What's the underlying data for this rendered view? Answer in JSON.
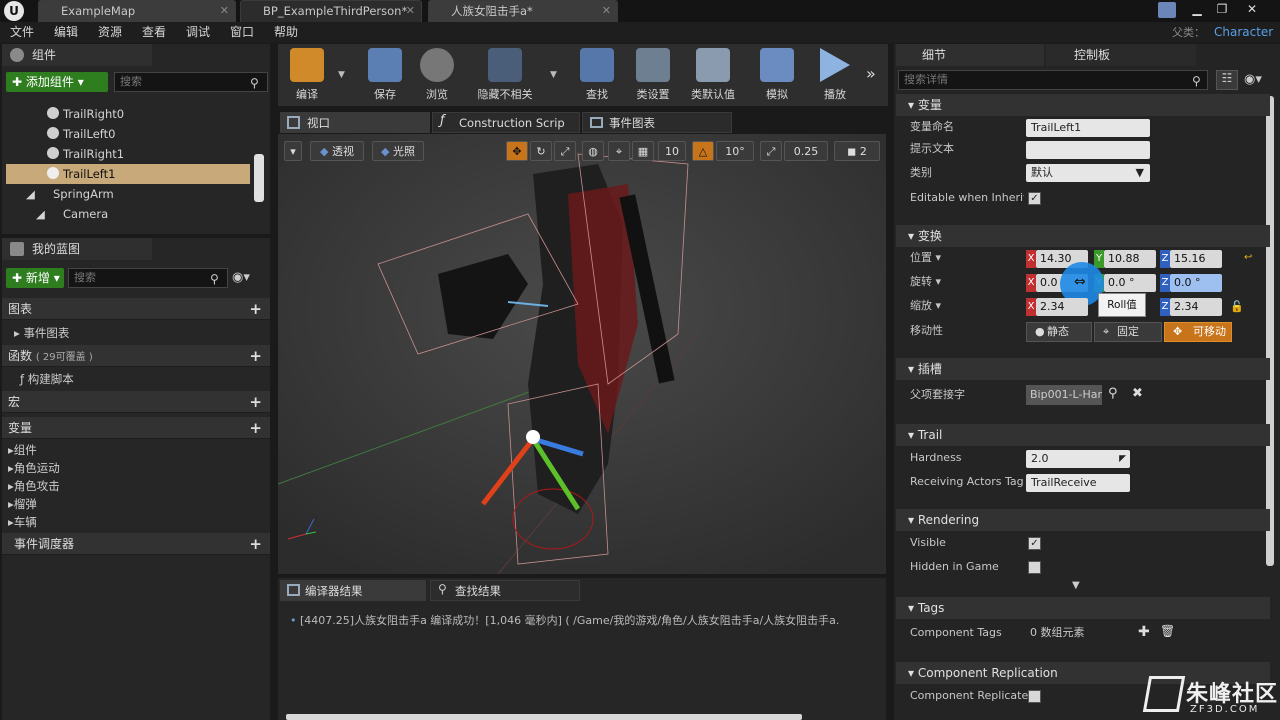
{
  "titlebar": {
    "tabs": [
      "ExampleMap",
      "BP_ExampleThirdPerson*",
      "人族女阻击手a*"
    ],
    "parent_label": "父类：",
    "parent_value": "Character"
  },
  "menu": [
    "文件",
    "编辑",
    "资源",
    "查看",
    "调试",
    "窗口",
    "帮助"
  ],
  "components": {
    "title": "组件",
    "add_button": "添加组件",
    "search_placeholder": "搜索",
    "items": [
      "TrailRight0",
      "TrailLeft0",
      "TrailRight1",
      "TrailLeft1",
      "SpringArm",
      "Camera"
    ],
    "selected": "TrailLeft1"
  },
  "my_blueprint": {
    "title": "我的蓝图",
    "new_button": "新增",
    "search_placeholder": "搜索",
    "graphs_label": "图表",
    "event_graph": "事件图表",
    "functions_label": "函数",
    "functions_count": "( 29可覆盖 )",
    "construction_script": "构建脚本",
    "macros_label": "宏",
    "variables_label": "变量",
    "variable_groups": [
      "组件",
      "角色运动",
      "角色攻击",
      "榴弹",
      "车辆"
    ],
    "dispatchers_label": "事件调度器"
  },
  "toolbar": {
    "buttons": [
      "编译",
      "保存",
      "浏览",
      "隐藏不相关",
      "查找",
      "类设置",
      "类默认值",
      "模拟",
      "播放"
    ]
  },
  "editor_tabs": [
    "视口",
    "Construction Scrip",
    "事件图表"
  ],
  "viewport": {
    "perspective": "透视",
    "lighting": "光照",
    "grid_snap": "10",
    "rot_snap": "10°",
    "scale_snap": "0.25",
    "camera_speed": "2"
  },
  "details": {
    "tabs": [
      "细节",
      "控制板"
    ],
    "search_placeholder": "搜索详情",
    "sections": {
      "variable": "变量",
      "transform": "变换",
      "socket": "插槽",
      "trail": "Trail",
      "rendering": "Rendering",
      "tags": "Tags",
      "replication": "Component Replication"
    },
    "variable_name_label": "变量命名",
    "variable_name": "TrailLeft1",
    "tooltip_label": "提示文本",
    "category_label": "类别",
    "category_value": "默认",
    "editable_label": "Editable when Inherite",
    "location_label": "位置",
    "location": {
      "x": "14.30",
      "y": "10.88",
      "z": "15.16"
    },
    "rotation_label": "旋转",
    "rotation": {
      "x": "0.0",
      "y": "0.0 °",
      "z": "0.0 °"
    },
    "scale_label": "缩放",
    "scale": {
      "x": "2.34",
      "z": "2.34"
    },
    "tooltip_popup": "Roll值",
    "mobility_label": "移动性",
    "mobility": [
      "静态",
      "固定",
      "可移动"
    ],
    "parent_socket_label": "父项套接字",
    "parent_socket": "Bip001-L-Har",
    "hardness_label": "Hardness",
    "hardness": "2.0",
    "receiving_label": "Receiving Actors Tag",
    "receiving_value": "TrailReceive",
    "visible_label": "Visible",
    "hidden_label": "Hidden in Game",
    "component_tags_label": "Component Tags",
    "component_tags_value": "0 数组元素",
    "replicates_label": "Component Replicates"
  },
  "output": {
    "tabs": [
      "编译器结果",
      "查找结果"
    ],
    "log": "[4407.25]人族女阻击手a 编译成功！[1,046 毫秒内] ( /Game/我的游戏/角色/人族女阻击手a/人族女阻击手a."
  },
  "watermark": {
    "name": "朱峰社区",
    "url": "ZF3D.COM"
  },
  "colors": {
    "accent_orange": "#c8741a",
    "green": "#2e7d1f",
    "selected_row": "#c8a97a"
  }
}
